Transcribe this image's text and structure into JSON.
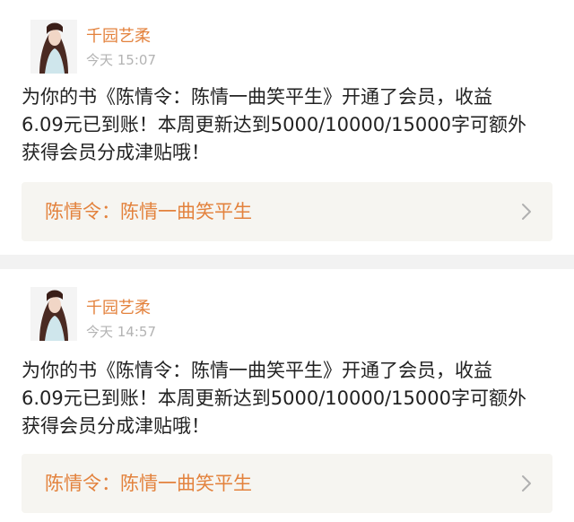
{
  "feed": {
    "items": [
      {
        "author": "千园艺柔",
        "time": "今天 15:07",
        "message_lines": [
          "为你的书《陈情令：陈情一曲笑平生》开通了会员，收益",
          "6.09元已到账！本周更新达到5000/10000/15000字可额外",
          "获得会员分成津贴哦！"
        ],
        "book_title": "陈情令：陈情一曲笑平生",
        "icons": {
          "avatar": "avatar-portrait",
          "link": "chevron-right-icon"
        }
      },
      {
        "author": "千园艺柔",
        "time": "今天 14:57",
        "message_lines": [
          "为你的书《陈情令：陈情一曲笑平生》开通了会员，收益",
          "6.09元已到账！本周更新达到5000/10000/15000字可额外",
          "获得会员分成津贴哦！"
        ],
        "book_title": "陈情令：陈情一曲笑平生",
        "icons": {
          "avatar": "avatar-portrait",
          "link": "chevron-right-icon"
        }
      }
    ]
  },
  "colors": {
    "accent": "#e3823d",
    "text": "#222222",
    "muted": "#b3b3b3",
    "link_background": "#f6f5f1",
    "separator": "#f2f2f2"
  }
}
